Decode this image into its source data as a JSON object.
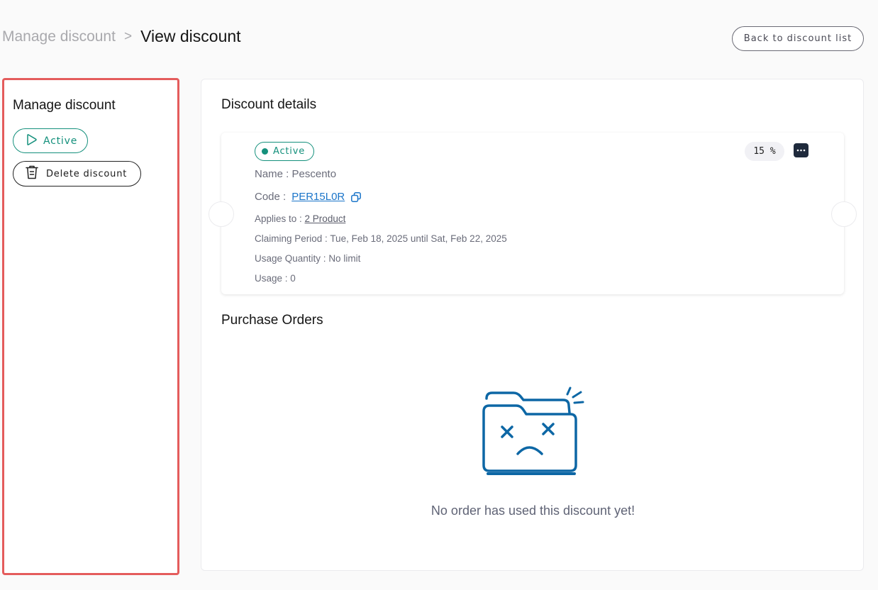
{
  "header": {
    "breadcrumb_parent": "Manage discount",
    "breadcrumb_separator": ">",
    "breadcrumb_current": "View discount",
    "back_button": "Back to discount list"
  },
  "sidebar": {
    "title": "Manage discount",
    "status_button": "Active",
    "delete_button": "Delete discount"
  },
  "details": {
    "title": "Discount details",
    "status": "Active",
    "name_label": "Name : ",
    "name_value": "Pescento",
    "code_label": "Code : ",
    "code_value": "PER15L0R",
    "applies_label": "Applies to : ",
    "applies_value": "2 Product",
    "claiming_label": "Claiming Period : ",
    "claiming_value": "Tue, Feb 18, 2025 until Sat, Feb 22, 2025",
    "quantity_label": "Usage Quantity : ",
    "quantity_value": "No limit",
    "usage_label": "Usage : ",
    "usage_value": "0",
    "percent": "15 %"
  },
  "orders": {
    "title": "Purchase Orders",
    "empty_message": "No order has used this discount yet!"
  },
  "colors": {
    "accent_green": "#14907c",
    "link_blue": "#1b75c9",
    "illustration_blue": "#0d67a5",
    "highlight_red": "#e45c5c"
  },
  "icons": [
    "play-outline-icon",
    "trash-icon",
    "copy-icon",
    "more-horizontal-icon",
    "sad-folder-illustration"
  ]
}
